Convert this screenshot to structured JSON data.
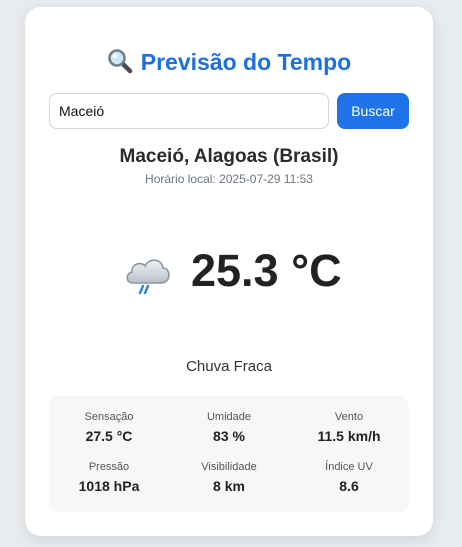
{
  "app": {
    "title": "Previsão do Tempo",
    "accent_color": "#1f73e8",
    "title_icon": "magnifying-glass-icon"
  },
  "search": {
    "value": "Maceió",
    "button_label": "Buscar"
  },
  "location": {
    "name": "Maceió, Alagoas (Brasil)",
    "local_time": "Horário local: 2025-07-29 11:53"
  },
  "current": {
    "icon": "cloud-rain-icon",
    "temperature": "25.3 °C",
    "condition": "Chuva Fraca"
  },
  "stats": [
    {
      "label": "Sensação",
      "value": "27.5 °C"
    },
    {
      "label": "Umidade",
      "value": "83 %"
    },
    {
      "label": "Vento",
      "value": "11.5 km/h"
    },
    {
      "label": "Pressão",
      "value": "1018 hPa"
    },
    {
      "label": "Visibilidade",
      "value": "8 km"
    },
    {
      "label": "Índice UV",
      "value": "8.6"
    }
  ]
}
